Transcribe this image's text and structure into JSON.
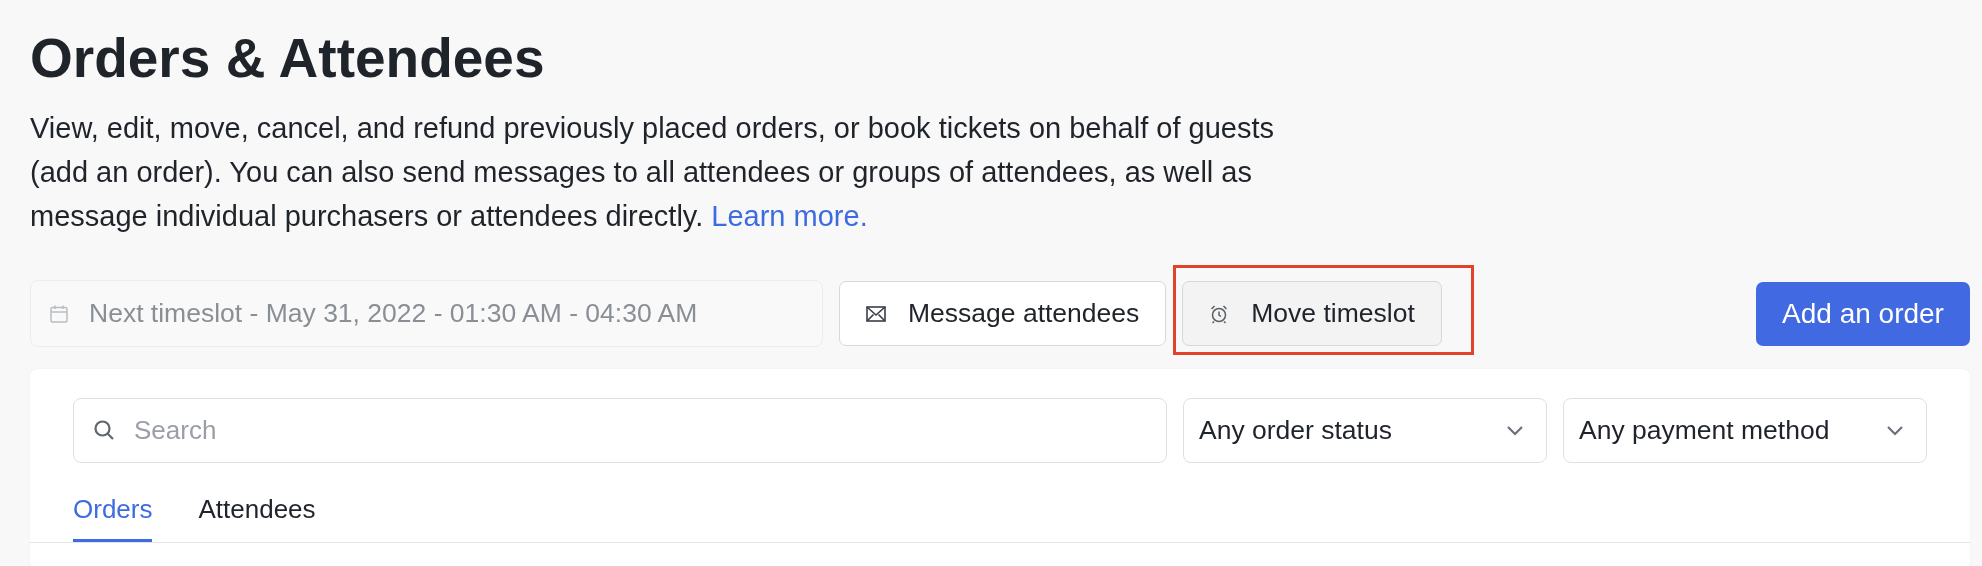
{
  "page": {
    "title": "Orders & Attendees",
    "description": "View, edit, move, cancel, and refund previously placed orders, or book tickets on behalf of guests (add an order). You can also send messages to all attendees or groups of attendees, as well as message individual purchasers or attendees directly.",
    "learn_more_link": "Learn more."
  },
  "timeslot_field": {
    "value": "Next timeslot - May 31, 2022 - 01:30 AM - 04:30 AM"
  },
  "toolbar_buttons": [
    {
      "kind": "mail",
      "label": "Message attendees",
      "highlighted": false
    },
    {
      "kind": "alarm",
      "label": "Move timeslot",
      "highlighted": true
    }
  ],
  "primary_button": {
    "label": "Add an order"
  },
  "search": {
    "placeholder": "Search"
  },
  "filters": [
    {
      "value": "Any order status"
    },
    {
      "value": "Any payment method"
    }
  ],
  "tabs": [
    {
      "label": "Orders",
      "selected": true
    },
    {
      "label": "Attendees",
      "selected": false
    }
  ]
}
